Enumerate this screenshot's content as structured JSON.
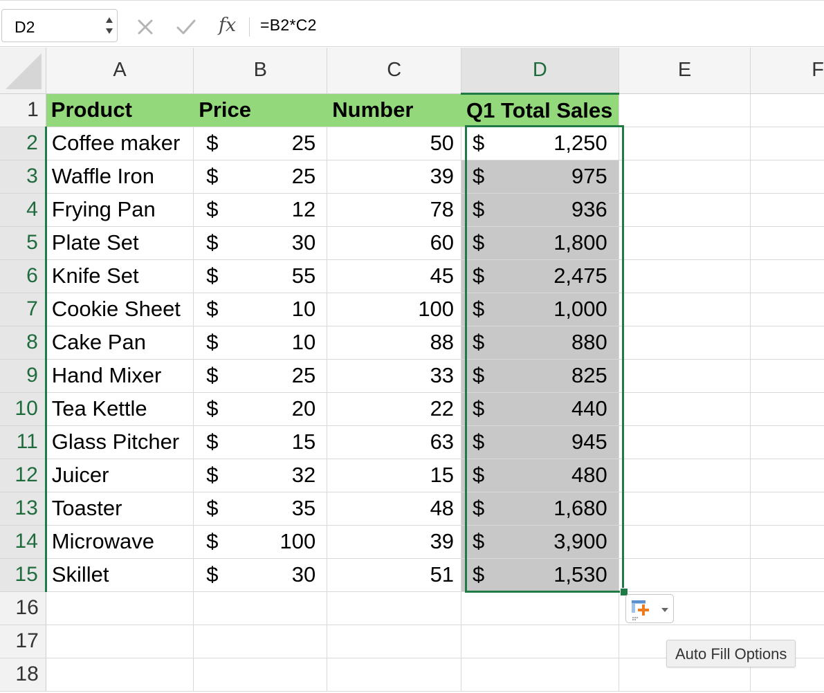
{
  "formula_bar": {
    "name_box": "D2",
    "formula": "=B2*C2",
    "fx_label": "fx"
  },
  "columns": [
    "A",
    "B",
    "C",
    "D",
    "E",
    "F"
  ],
  "selected_column": "D",
  "header_row": {
    "row_number": "1",
    "product": "Product",
    "price": "Price",
    "number": "Number",
    "total": "Q1 Total Sales"
  },
  "currency_symbol": "$",
  "rows": [
    {
      "n": "2",
      "product": "Coffee maker",
      "price": "25",
      "number": "50",
      "total": "1,250"
    },
    {
      "n": "3",
      "product": "Waffle Iron",
      "price": "25",
      "number": "39",
      "total": "975"
    },
    {
      "n": "4",
      "product": "Frying Pan",
      "price": "12",
      "number": "78",
      "total": "936"
    },
    {
      "n": "5",
      "product": "Plate Set",
      "price": "30",
      "number": "60",
      "total": "1,800"
    },
    {
      "n": "6",
      "product": "Knife Set",
      "price": "55",
      "number": "45",
      "total": "2,475"
    },
    {
      "n": "7",
      "product": "Cookie Sheet",
      "price": "10",
      "number": "100",
      "total": "1,000"
    },
    {
      "n": "8",
      "product": "Cake Pan",
      "price": "10",
      "number": "88",
      "total": "880"
    },
    {
      "n": "9",
      "product": "Hand Mixer",
      "price": "25",
      "number": "33",
      "total": "825"
    },
    {
      "n": "10",
      "product": "Tea Kettle",
      "price": "20",
      "number": "22",
      "total": "440"
    },
    {
      "n": "11",
      "product": "Glass Pitcher",
      "price": "15",
      "number": "63",
      "total": "945"
    },
    {
      "n": "12",
      "product": "Juicer",
      "price": "32",
      "number": "15",
      "total": "480"
    },
    {
      "n": "13",
      "product": "Toaster",
      "price": "35",
      "number": "48",
      "total": "1,680"
    },
    {
      "n": "14",
      "product": "Microwave",
      "price": "100",
      "number": "39",
      "total": "3,900"
    },
    {
      "n": "15",
      "product": "Skillet",
      "price": "30",
      "number": "51",
      "total": "1,530"
    }
  ],
  "empty_rows": [
    "16",
    "17",
    "18"
  ],
  "autofill": {
    "tooltip": "Auto Fill Options"
  },
  "colors": {
    "header_fill": "#93d97b",
    "selection": "#1f7a45",
    "selected_fill": "#c8c8c8"
  },
  "icons": [
    "cancel-icon",
    "enter-icon",
    "fx-icon",
    "autofill-icon",
    "chevron-down-icon",
    "stepper-icon"
  ]
}
